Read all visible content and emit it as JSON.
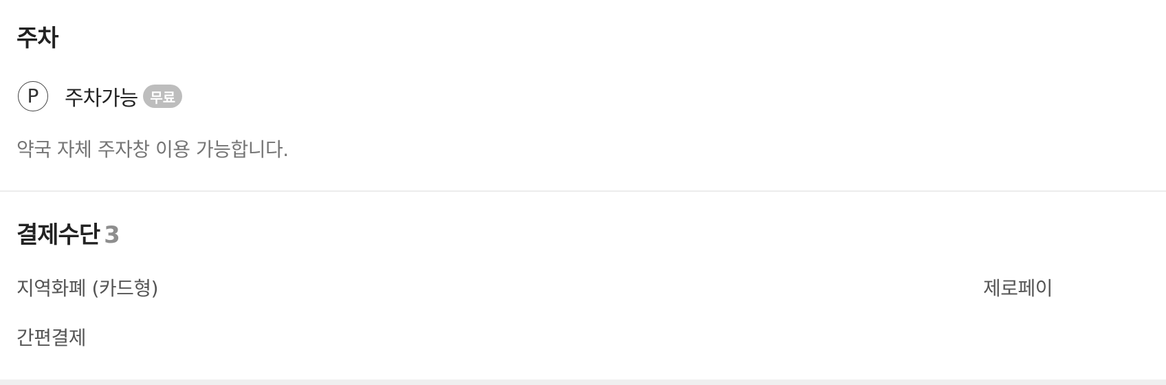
{
  "parking": {
    "title": "주차",
    "icon": "parking-icon",
    "icon_glyph": "P",
    "status": "주차가능",
    "badge": "무료",
    "badge_color": "#bdbdbd",
    "description": "약국 자체 주자창 이용 가능합니다."
  },
  "payment": {
    "title": "결제수단",
    "count": "3",
    "items": [
      "지역화폐 (카드형)",
      "제로페이",
      "간편결제"
    ]
  }
}
